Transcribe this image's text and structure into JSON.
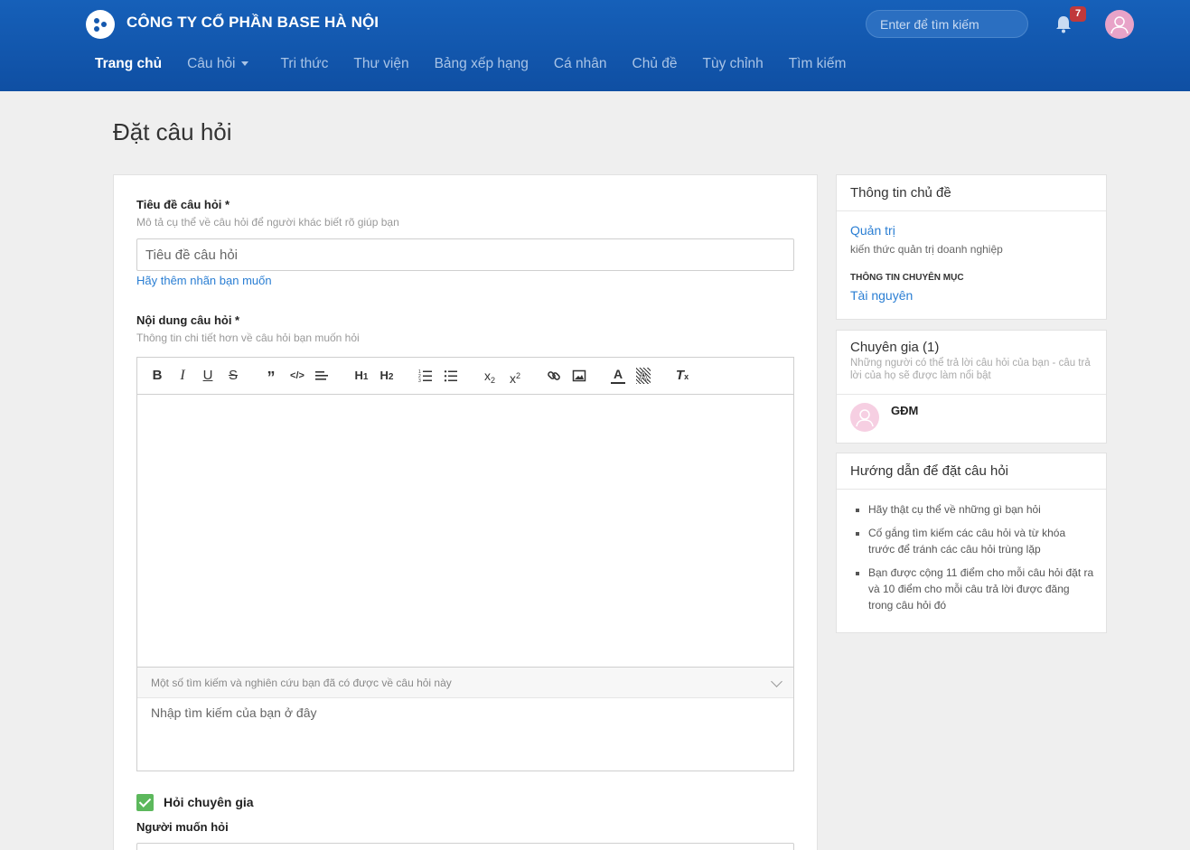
{
  "header": {
    "company_name": "CÔNG TY CỔ PHẦN BASE HÀ NỘI",
    "search_placeholder": "Enter để tìm kiếm",
    "notification_count": "7",
    "nav": [
      {
        "label": "Trang chủ",
        "active": true
      },
      {
        "label": "Câu hỏi",
        "has_dropdown": true
      },
      {
        "label": "Tri thức"
      },
      {
        "label": "Thư viện"
      },
      {
        "label": "Bảng xếp hạng"
      },
      {
        "label": "Cá nhân"
      },
      {
        "label": "Chủ đề"
      },
      {
        "label": "Tùy chỉnh"
      },
      {
        "label": "Tìm kiếm"
      }
    ]
  },
  "page": {
    "title": "Đặt câu hỏi"
  },
  "form": {
    "title_label": "Tiêu đề câu hỏi *",
    "title_help": "Mô tả cụ thể về câu hỏi để người khác biết rõ giúp bạn",
    "title_placeholder": "Tiêu đề câu hỏi",
    "add_tags_link": "Hãy thêm nhãn bạn muốn",
    "content_label": "Nội dung câu hỏi *",
    "content_help": "Thông tin chi tiết hơn về câu hỏi bạn muốn hỏi",
    "toolbar_icons": [
      "bold-icon",
      "italic-icon",
      "underline-icon",
      "strikethrough-icon",
      "blockquote-icon",
      "code-icon",
      "align-icon",
      "heading-1-icon",
      "heading-2-icon",
      "ordered-list-icon",
      "bullet-list-icon",
      "subscript-icon",
      "superscript-icon",
      "link-icon",
      "image-icon",
      "text-color-icon",
      "background-color-icon",
      "clear-format-icon"
    ],
    "research_header": "Một số tìm kiếm và nghiên cứu bạn đã có được về câu hỏi này",
    "research_placeholder": "Nhập tìm kiếm của bạn ở đây",
    "ask_expert_label": "Hỏi chuyên gia",
    "ask_expert_checked": true,
    "target_person_label": "Người muốn hỏi"
  },
  "sidebar": {
    "topic_info": {
      "title": "Thông tin chủ đề",
      "topic_name": "Quản trị",
      "topic_desc": "kiến thức quản trị doanh nghiệp",
      "category_label": "THÔNG TIN CHUYÊN MỤC",
      "category_value": "Tài nguyên"
    },
    "experts": {
      "title": "Chuyên gia (1)",
      "desc": "Những người có thể trả lời câu hỏi của bạn - câu trả lời của họ sẽ được làm nổi bật",
      "items": [
        {
          "name": "GĐM"
        }
      ]
    },
    "guide": {
      "title": "Hướng dẫn để đặt câu hỏi",
      "items": [
        "Hãy thật cụ thể về những gì bạn hỏi",
        "Cố gắng tìm kiếm các câu hỏi và từ khóa trước để tránh các câu hỏi trùng lặp",
        "Bạn được cộng 11 điểm cho mỗi câu hỏi đặt ra và 10 điểm cho mỗi câu trả lời được đăng trong câu hỏi đó"
      ]
    }
  }
}
